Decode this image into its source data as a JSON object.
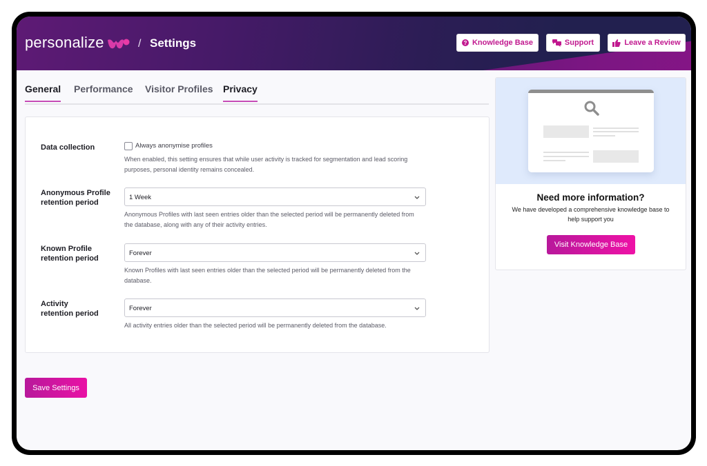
{
  "header": {
    "logo_text": "personalize",
    "breadcrumb_separator": "/",
    "page_title": "Settings",
    "buttons": [
      {
        "label": "Knowledge Base",
        "icon": "question-circle-icon"
      },
      {
        "label": "Support",
        "icon": "chat-bubbles-icon"
      },
      {
        "label": "Leave a Review",
        "icon": "thumbs-up-icon"
      }
    ],
    "accent_color": "#c1198f"
  },
  "tabs": [
    {
      "label": "General",
      "active": true
    },
    {
      "label": "Performance",
      "active": false
    },
    {
      "label": "Visitor Profiles",
      "active": false
    },
    {
      "label": "Privacy",
      "active": true
    }
  ],
  "settings": {
    "data_collection": {
      "label": "Data collection",
      "checkbox_label": "Always anonymise profiles",
      "checked": false,
      "help_line1": "When enabled, this setting ensures that while user activity is tracked for segmentation and lead scoring",
      "help_line2": "purposes, personal identity remains concealed."
    },
    "anonymous_retention": {
      "label_line1": "Anonymous Profile",
      "label_line2": "retention period",
      "value": "1 Week",
      "help_line1": "Anonymous Profiles with last seen entries older than the selected period will be permanently deleted from",
      "help_line2": "the database, along with any of their activity entries."
    },
    "known_retention": {
      "label_line1": "Known Profile",
      "label_line2": "retention period",
      "value": "Forever",
      "help_line1": "Known Profiles with last seen entries older than the selected period will be permanently deleted from the",
      "help_line2": "database."
    },
    "activity_retention": {
      "label_line1": "Activity",
      "label_line2": "retention period",
      "value": "Forever",
      "help_line1": "All activity entries older than the selected period will be permanently deleted from the database."
    }
  },
  "save_button": "Save Settings",
  "sidebar": {
    "title": "Need more information?",
    "text_line1": "We have developed a comprehensive knowledge base to",
    "text_line2": "help support you",
    "button": "Visit Knowledge Base"
  }
}
